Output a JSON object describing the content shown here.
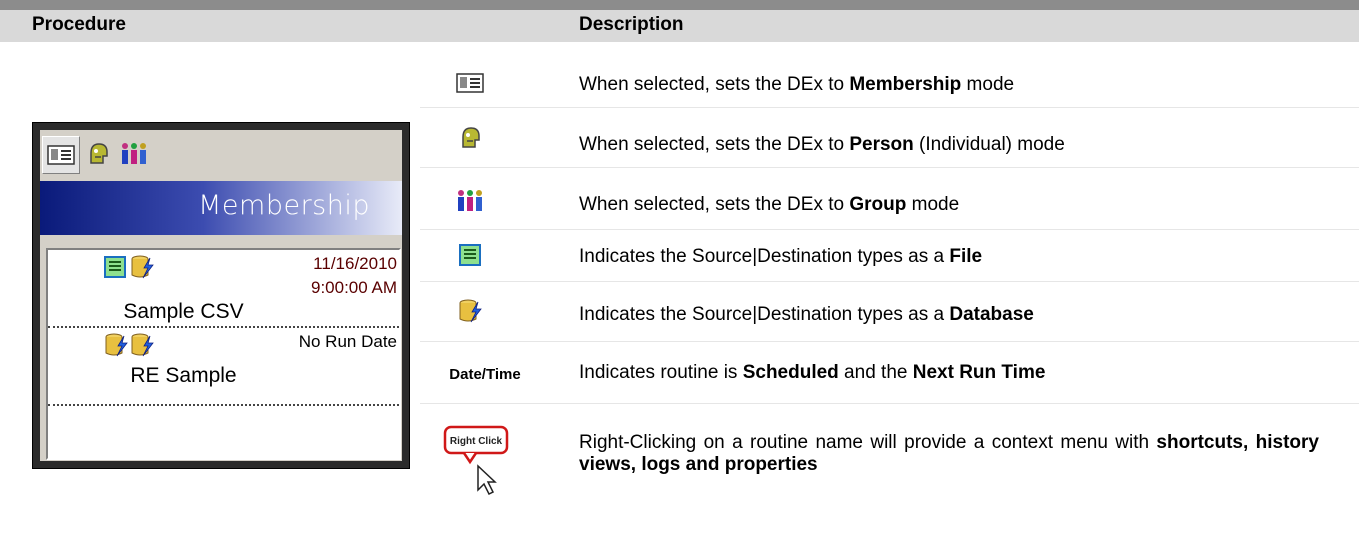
{
  "header": {
    "procedure": "Procedure",
    "description": "Description"
  },
  "panel": {
    "mode_label": "Membership",
    "routines": [
      {
        "name": "Sample CSV",
        "date": "11/16/2010",
        "time": "9:00:00  AM",
        "icons": [
          "file-icon",
          "database-icon"
        ]
      },
      {
        "name": "RE Sample",
        "date": "No Run Date",
        "icons": [
          "database-icon",
          "database-icon"
        ]
      }
    ]
  },
  "rows": [
    {
      "icon": "membership-icon",
      "pre": "When selected, sets the DEx to ",
      "bold": "Membership",
      "post": " mode"
    },
    {
      "icon": "person-icon",
      "pre": "When selected, sets the DEx to ",
      "bold": "Person",
      "post": " (Individual) mode"
    },
    {
      "icon": "group-icon",
      "pre": "When selected, sets the DEx to ",
      "bold": "Group",
      "post": " mode"
    },
    {
      "icon": "file-icon",
      "pre": "Indicates the Source|Destination types as a ",
      "bold": "File",
      "post": ""
    },
    {
      "icon": "database-icon",
      "pre": "Indicates the Source|Destination types as a ",
      "bold": "Database",
      "post": ""
    },
    {
      "label": "Date/Time",
      "pre": "Indicates routine is ",
      "bold": "Scheduled",
      "mid": " and the ",
      "bold2": "Next Run Time"
    },
    {
      "icon": "right-click-icon",
      "icon_text": "Right Click",
      "pre": "Right-Clicking on a routine name will provide a context menu with ",
      "bold": "shortcuts, history views, logs and properties"
    }
  ]
}
